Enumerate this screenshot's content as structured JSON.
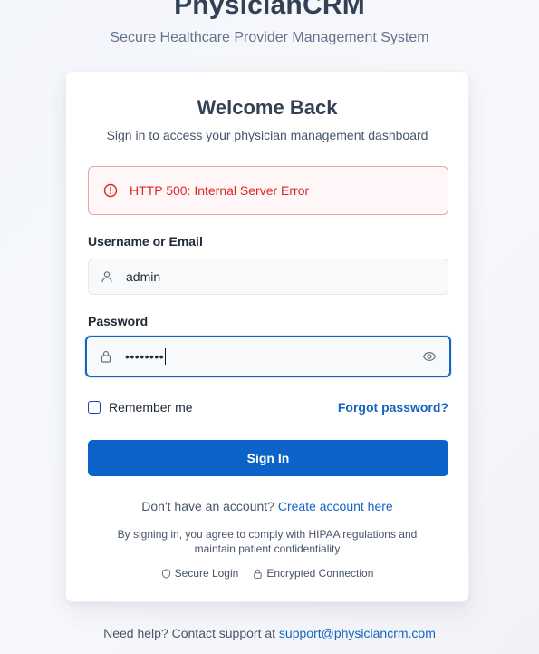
{
  "brand": {
    "title": "PhysicianCRM",
    "subtitle": "Secure Healthcare Provider Management System"
  },
  "card": {
    "title": "Welcome Back",
    "subtitle": "Sign in to access your physician management dashboard"
  },
  "error": {
    "icon": "alert-circle-icon",
    "message": "HTTP 500: Internal Server Error",
    "color": "#dc2626"
  },
  "username": {
    "label": "Username or Email",
    "icon": "user-icon",
    "value": "admin"
  },
  "password": {
    "label": "Password",
    "icon": "lock-icon",
    "masked_value": "••••••••",
    "toggle_icon": "eye-icon"
  },
  "remember": {
    "label": "Remember me",
    "checked": false
  },
  "forgot": {
    "label": "Forgot password?"
  },
  "signin": {
    "label": "Sign In",
    "color": "#0b63c9"
  },
  "signup": {
    "prompt": "Don't have an account?",
    "link": "Create account here"
  },
  "compliance": {
    "line1": "By signing in, you agree to comply with HIPAA regulations and",
    "line2": "maintain patient confidentiality"
  },
  "security": {
    "items": [
      {
        "icon": "shield-icon",
        "label": "Secure Login"
      },
      {
        "icon": "lock-icon",
        "label": "Encrypted Connection"
      }
    ]
  },
  "help": {
    "prompt": "Need help? Contact support at",
    "email": "support@physiciancrm.com"
  },
  "colors": {
    "accent": "#1565c0"
  }
}
